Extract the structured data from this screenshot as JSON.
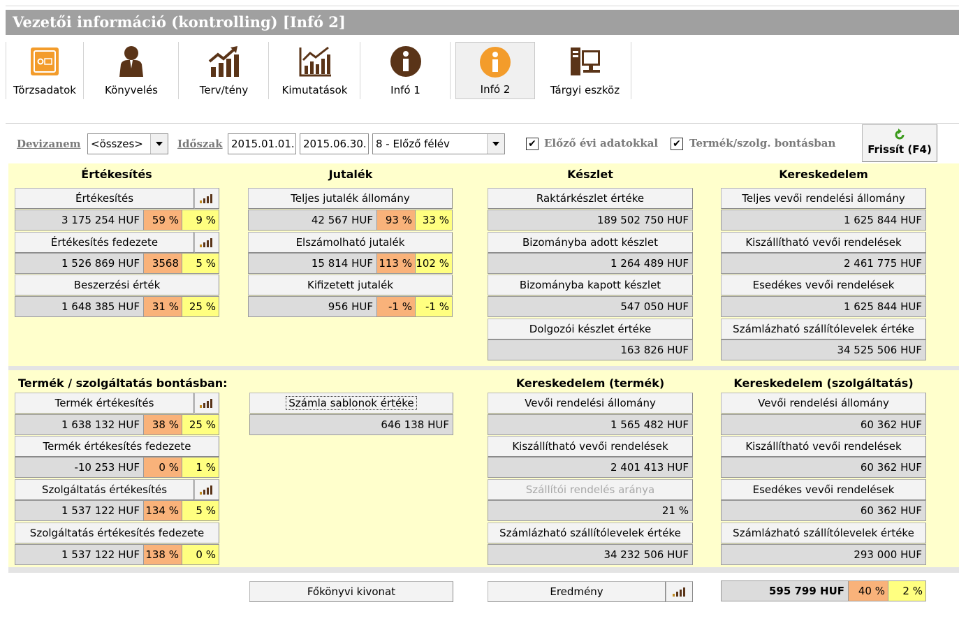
{
  "window_title": "Vezetői információ (kontrolling) [Infó 2]",
  "toolbar": {
    "items": [
      {
        "label": "Törzsadatok",
        "icon": "safe-icon"
      },
      {
        "label": "Könyvelés",
        "icon": "person-icon"
      },
      {
        "label": "Terv/tény",
        "icon": "chart-up-icon"
      },
      {
        "label": "Kimutatások",
        "icon": "bar-chart-icon"
      },
      {
        "label": "Infó 1",
        "icon": "info-icon"
      },
      {
        "label": "Infó 2",
        "icon": "info-icon",
        "active": true
      },
      {
        "label": "Tárgyi eszköz",
        "icon": "computer-icon"
      }
    ]
  },
  "filter": {
    "devizanem_label": "Devizanem",
    "devizanem_value": "<összes>",
    "idoszak_label": "Időszak",
    "date_from": "2015.01.01.",
    "date_to": "2015.06.30.",
    "period_value": "8 - Előző félév",
    "prev_year_label": "Előző évi adatokkal",
    "product_split_label": "Termék/szolg. bontásban",
    "refresh_label": "Frissít (F4)"
  },
  "ertekesites": {
    "title": "Értékesítés",
    "rows": [
      {
        "button": "Értékesítés",
        "value": "3 175 254 HUF",
        "p1": "59 %",
        "p2": "9 %"
      },
      {
        "button": "Értékesítés fedezete",
        "value": "1 526 869 HUF",
        "p1": "3568",
        "p2": "5 %"
      },
      {
        "button": "Beszerzési érték",
        "value": "1 648 385 HUF",
        "p1": "31 %",
        "p2": "25 %"
      }
    ]
  },
  "jutalek": {
    "title": "Jutalék",
    "rows": [
      {
        "button": "Teljes jutalék állomány",
        "value": "42 567 HUF",
        "p1": "93 %",
        "p2": "33 %"
      },
      {
        "button": "Elszámolható jutalék",
        "value": "15 814 HUF",
        "p1": "113 %",
        "p2": "102 %"
      },
      {
        "button": "Kifizetett jutalék",
        "value": "956 HUF",
        "p1": "-1 %",
        "p2": "-1 %"
      }
    ]
  },
  "keszlet": {
    "title": "Készlet",
    "rows": [
      {
        "button": "Raktárkészlet értéke",
        "value": "189 502 750 HUF"
      },
      {
        "button": "Bizományba adott készlet",
        "value": "1 264 489 HUF"
      },
      {
        "button": "Bizományba kapott készlet",
        "value": "547 050 HUF"
      },
      {
        "button": "Dolgozói készlet értéke",
        "value": "163 826 HUF"
      }
    ]
  },
  "kereskedelem": {
    "title": "Kereskedelem",
    "rows": [
      {
        "button": "Teljes vevői rendelési állomány",
        "value": "1 625 844 HUF"
      },
      {
        "button": "Kiszállítható vevői rendelések",
        "value": "2 461 775 HUF"
      },
      {
        "button": "Esedékes vevői rendelések",
        "value": "1 625 844 HUF"
      },
      {
        "button": "Számlázható szállítólevelek értéke",
        "value": "34 525 506 HUF"
      }
    ]
  },
  "termek_szolg": {
    "title": "Termék / szolgáltatás bontásban:",
    "rows": [
      {
        "button": "Termék értékesítés",
        "value": "1 638 132 HUF",
        "p1": "38 %",
        "p2": "25 %"
      },
      {
        "button": "Termék értékesítés fedezete",
        "value": "-10 253 HUF",
        "p1": "0 %",
        "p2": "1 %"
      },
      {
        "button": "Szolgáltatás értékesítés",
        "value": "1 537 122 HUF",
        "p1": "134 %",
        "p2": "5 %"
      },
      {
        "button": "Szolgáltatás értékesítés fedezete",
        "value": "1 537 122 HUF",
        "p1": "138 %",
        "p2": "0 %"
      }
    ]
  },
  "szamla_sablon": {
    "button": "Számla sablonok értéke",
    "value": "646 138 HUF"
  },
  "ker_termek": {
    "title": "Kereskedelem (termék)",
    "rows": [
      {
        "button": "Vevői rendelési állomány",
        "value": "1 565 482 HUF"
      },
      {
        "button": "Kiszállítható vevői rendelések",
        "value": "2 401 413 HUF"
      },
      {
        "button": "Szállítói rendelés aránya",
        "value": "21 %"
      },
      {
        "button": "Számlázható szállítólevelek értéke",
        "value": "34 232 506 HUF"
      }
    ]
  },
  "ker_szolg": {
    "title": "Kereskedelem (szolgáltatás)",
    "rows": [
      {
        "button": "Vevői rendelési állomány",
        "value": "60 362 HUF"
      },
      {
        "button": "Kiszállítható vevői rendelések",
        "value": "60 362 HUF"
      },
      {
        "button": "Esedékes vevői rendelések",
        "value": "60 362 HUF"
      },
      {
        "button": "Számlázható szállítólevelek értéke",
        "value": "293 000 HUF"
      }
    ]
  },
  "bottom": {
    "fokonyvi": "Főkönyvi kivonat",
    "eredmeny": "Eredmény",
    "result_value": "595 799 HUF",
    "result_p1": "40 %",
    "result_p2": "2 %"
  },
  "colors": {
    "panel": "#ffffcc",
    "orange": "#f9b27a",
    "yellow": "#ffff80",
    "title_bar": "#a0a0a0",
    "accent_orange": "#f39c2b"
  }
}
